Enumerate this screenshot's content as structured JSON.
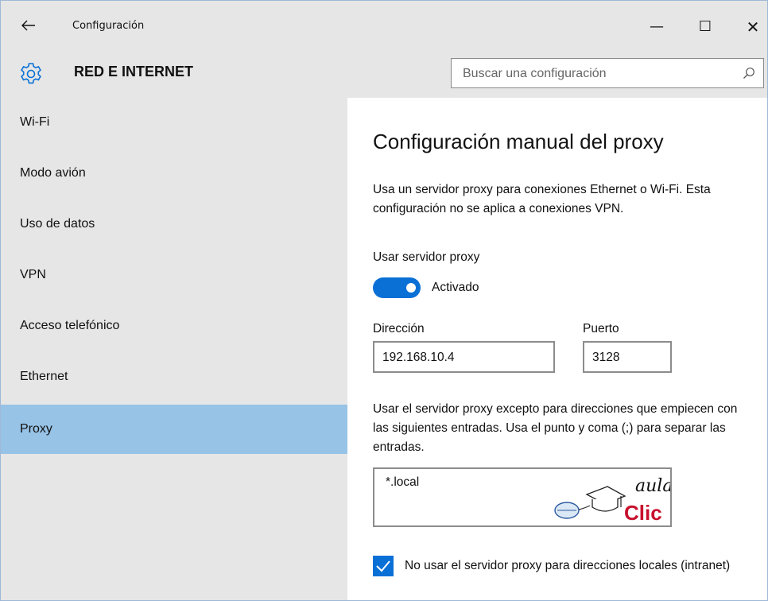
{
  "window": {
    "title": "Configuración",
    "back_icon": "arrow-left-icon",
    "minimize_glyph": "—",
    "maximize_glyph": "☐",
    "close_glyph": "✕"
  },
  "header": {
    "icon": "gear-icon",
    "title": "RED E INTERNET",
    "search_placeholder": "Buscar una configuración"
  },
  "sidebar": {
    "items": [
      {
        "label": "Wi-Fi",
        "active": false
      },
      {
        "label": "Modo avión",
        "active": false
      },
      {
        "label": "Uso de datos",
        "active": false
      },
      {
        "label": "VPN",
        "active": false
      },
      {
        "label": "Acceso telefónico",
        "active": false
      },
      {
        "label": "Ethernet",
        "active": false
      },
      {
        "label": "Proxy",
        "active": true
      }
    ]
  },
  "main": {
    "title": "Configuración manual del proxy",
    "description": "Usa un servidor proxy para conexiones Ethernet o Wi-Fi. Esta configuración no se aplica a conexiones VPN.",
    "use_proxy_label": "Usar servidor proxy",
    "toggle_state": "Activado",
    "address_label": "Dirección",
    "address_value": "192.168.10.4",
    "port_label": "Puerto",
    "port_value": "3128",
    "exceptions_text": "Usar el servidor proxy excepto para direcciones que empiecen con las siguientes entradas. Usa el punto y coma (;) para separar las entradas.",
    "exceptions_value": "*.local",
    "watermark_text_top": "aula",
    "watermark_text_bottom": "Clic",
    "bypass_local_checked": true,
    "bypass_local_label": "No usar el servidor proxy para direcciones locales (intranet)"
  },
  "colors": {
    "accent": "#0a70d6",
    "sidebar_bg": "#e6e6e6",
    "active_item_bg": "#97c3e6",
    "watermark_red": "#c8102e"
  }
}
